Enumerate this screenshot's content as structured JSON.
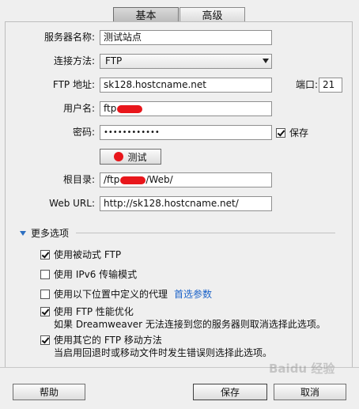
{
  "tabs": {
    "basic": "基本",
    "advanced": "高级"
  },
  "form": {
    "server_name_label": "服务器名称:",
    "server_name_value": "测试站点",
    "connect_method_label": "连接方法:",
    "connect_method_value": "FTP",
    "ftp_address_label": "FTP 地址:",
    "ftp_address_value": "sk128.hostcname.net",
    "port_label": "端口:",
    "port_value": "21",
    "username_label": "用户名:",
    "username_value": "ftp",
    "password_label": "密码:",
    "password_value": "••••••••••••",
    "save_label": "保存",
    "test_button": "测试",
    "root_dir_label": "根目录:",
    "root_dir_prefix": "/ftp",
    "root_dir_suffix": "/Web/",
    "web_url_label": "Web URL:",
    "web_url_value": "http://sk128.hostcname.net/"
  },
  "more_options": {
    "title": "更多选项",
    "passive_ftp": "使用被动式 FTP",
    "ipv6": "使用 IPv6 传输模式",
    "proxy": "使用以下位置中定义的代理",
    "proxy_link": "首选参数",
    "ftp_perf": "使用 FTP 性能优化",
    "ftp_perf_desc": "如果 Dreamweaver 无法连接到您的服务器则取消选择此选项。",
    "ftp_move": "使用其它的 FTP 移动方法",
    "ftp_move_desc": "当启用回退时或移动文件时发生错误则选择此选项。"
  },
  "footer": {
    "help": "帮助",
    "save": "保存",
    "cancel": "取消"
  },
  "watermark": "Baidu 经验"
}
